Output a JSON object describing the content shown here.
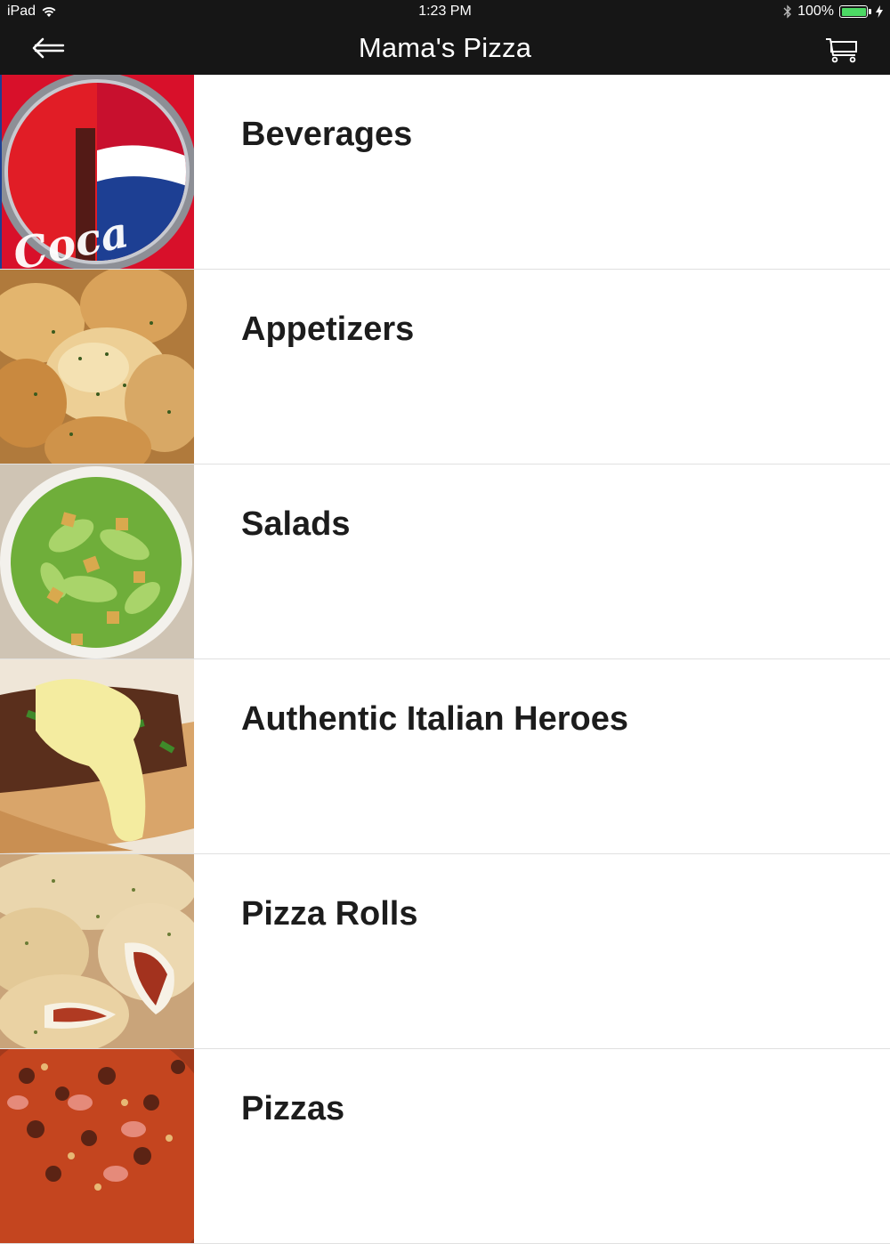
{
  "status_bar": {
    "device": "iPad",
    "time": "1:23 PM",
    "battery": "100%"
  },
  "nav": {
    "title": "Mama's Pizza",
    "back_icon": "back-arrow-icon",
    "cart_icon": "cart-icon"
  },
  "categories": [
    {
      "label": "Beverages",
      "image": "beverages-image"
    },
    {
      "label": "Appetizers",
      "image": "appetizers-image"
    },
    {
      "label": "Salads",
      "image": "salads-image"
    },
    {
      "label": "Authentic Italian Heroes",
      "image": "heroes-image"
    },
    {
      "label": "Pizza Rolls",
      "image": "pizza-rolls-image"
    },
    {
      "label": "Pizzas",
      "image": "pizzas-image"
    }
  ],
  "colors": {
    "bar_background": "#161616",
    "battery_green": "#4cd964",
    "label_text": "#1c1c1c"
  }
}
